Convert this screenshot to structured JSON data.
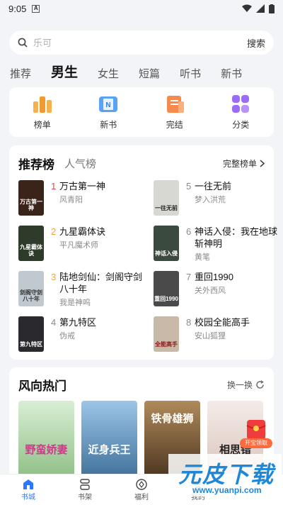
{
  "status_bar": {
    "time": "9:05"
  },
  "search": {
    "placeholder": "乐可",
    "button": "搜索"
  },
  "tabs": [
    "推荐",
    "男生",
    "女生",
    "短篇",
    "听书",
    "新书"
  ],
  "quick_links": [
    {
      "label": "榜单",
      "icon": "ranking-icon",
      "color": "#f5a43a"
    },
    {
      "label": "新书",
      "icon": "new-book-icon",
      "color": "#3d8cf0"
    },
    {
      "label": "完结",
      "icon": "finished-icon",
      "color": "#f47a3c"
    },
    {
      "label": "分类",
      "icon": "category-icon",
      "color": "#8a5cf6"
    }
  ],
  "recommend": {
    "title": "推荐榜",
    "tab2": "人气榜",
    "more": "完整榜单",
    "books": [
      {
        "rank": "1",
        "title": "万古第一神",
        "author": "风青阳",
        "cover_text": "万古第一神",
        "cover_color": "#3a2318"
      },
      {
        "rank": "2",
        "title": "九星霸体诀",
        "author": "平凡魔术师",
        "cover_text": "九星霸体诀",
        "cover_color": "#2e3a2a"
      },
      {
        "rank": "3",
        "title": "陆地剑仙：剑阁守剑八十年",
        "author": "我是神呜",
        "cover_text": "剑阁守剑八十年",
        "cover_color": "#bfc9cf"
      },
      {
        "rank": "4",
        "title": "第九特区",
        "author": "伪戒",
        "cover_text": "第九特区",
        "cover_color": "#2a2a2e"
      },
      {
        "rank": "5",
        "title": "一往无前",
        "author": "梦入洪荒",
        "cover_text": "一往无前",
        "cover_color": "#d8d8d2"
      },
      {
        "rank": "6",
        "title": "神话入侵：我在地球斩神明",
        "author": "黄笔",
        "cover_text": "神话入侵",
        "cover_color": "#3b4a3e"
      },
      {
        "rank": "7",
        "title": "重回1990",
        "author": "关外西风",
        "cover_text": "重回1990",
        "cover_color": "#4a4a4a"
      },
      {
        "rank": "8",
        "title": "校园全能高手",
        "author": "安山狐狸",
        "cover_text": "全能高手",
        "cover_color": "#c9b9a8"
      }
    ]
  },
  "hot": {
    "title": "风向热门",
    "refresh": "换一换",
    "covers": [
      {
        "text": "野蛮娇妻",
        "color": "#a9d3a0"
      },
      {
        "text": "近身兵王",
        "color": "#6a9fc8"
      },
      {
        "text": "铁骨雄狮",
        "color": "#7a5a3a"
      },
      {
        "text": "相思错",
        "color": "#e8d6d0"
      }
    ]
  },
  "redpack": {
    "label": "开宝领取"
  },
  "bottom_nav": [
    {
      "label": "书城",
      "icon": "bookstore-icon"
    },
    {
      "label": "书架",
      "icon": "bookshelf-icon"
    },
    {
      "label": "福利",
      "icon": "welfare-icon"
    },
    {
      "label": "我的",
      "icon": "profile-icon"
    }
  ],
  "watermark": {
    "main": "元皮下载",
    "url": "www.yuanpi.com"
  },
  "colors": {
    "accent": "#2c78ff",
    "rank_top": "#e8463a",
    "rank_mid": "#f5a43a",
    "rank_rest": "#8a8a8a"
  }
}
